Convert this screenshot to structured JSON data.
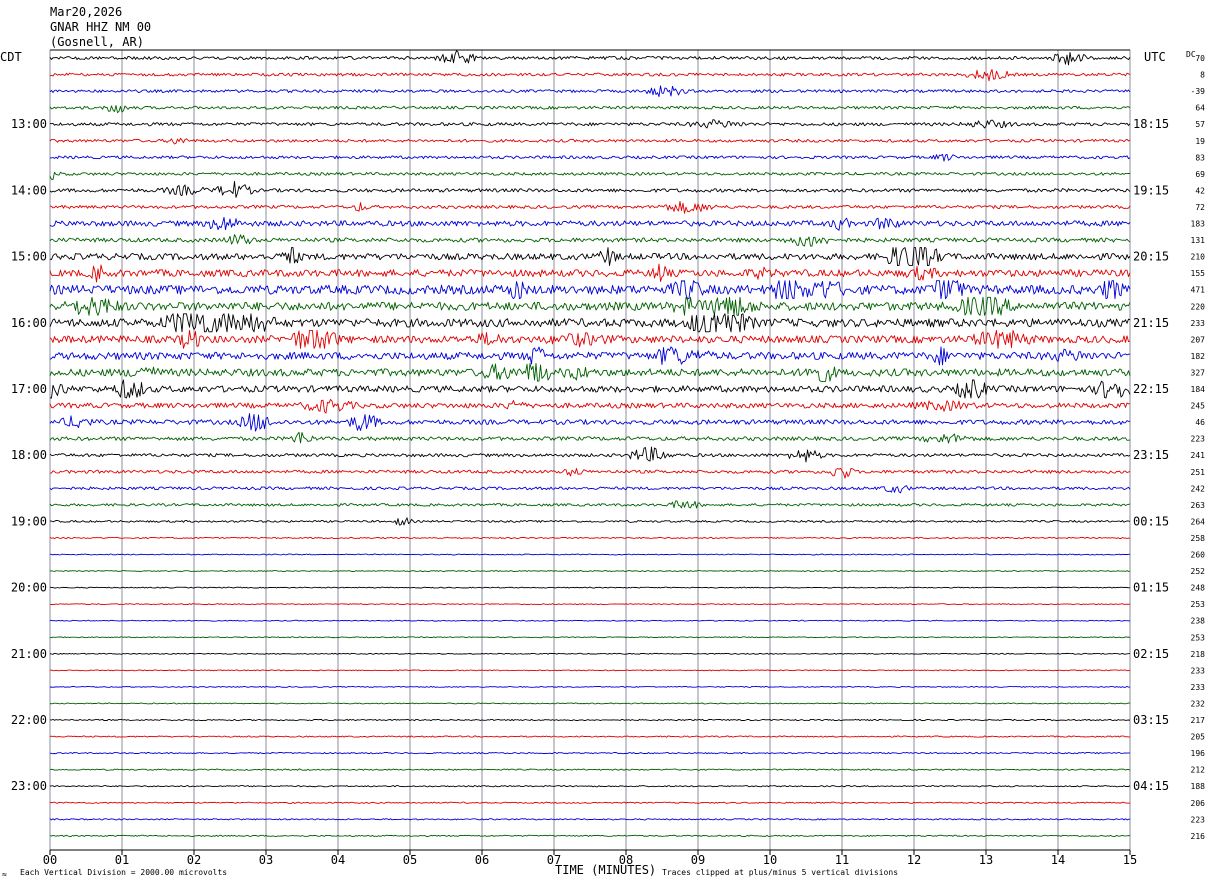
{
  "header": {
    "date": "Mar20,2026",
    "station": "GNAR HHZ NM 00",
    "location": "(Gosnell, AR)"
  },
  "left_tz_label": "CDT",
  "right_tz_label": "UTC",
  "dc_label": "DC",
  "footer": {
    "scale_note": "Each Vertical Division = 2000.00 microvolts",
    "clip_note": "Traces clipped at plus/minus 5 vertical divisions",
    "corner_mark": "≈"
  },
  "colors": {
    "trace_cycle": [
      "#000000",
      "#e00000",
      "#0000d8",
      "#006000"
    ],
    "gridline": "#8c8c9c"
  },
  "chart_data": {
    "type": "helicorder",
    "xlabel": "TIME (MINUTES)",
    "xlim": [
      0,
      15
    ],
    "x_tick_labels": [
      "00",
      "01",
      "02",
      "03",
      "04",
      "05",
      "06",
      "07",
      "08",
      "09",
      "10",
      "11",
      "12",
      "13",
      "14",
      "15"
    ],
    "left_time_labels": [
      "13:00",
      "14:00",
      "15:00",
      "16:00",
      "17:00",
      "18:00",
      "19:00",
      "20:00",
      "21:00",
      "22:00",
      "23:00"
    ],
    "right_time_labels": [
      "18:15",
      "19:15",
      "20:15",
      "21:15",
      "22:15",
      "23:15",
      "00:15",
      "01:15",
      "02:15",
      "03:15",
      "04:15"
    ],
    "rows_per_hour": 4,
    "first_row_offset_minutes": -60,
    "dc_offsets": [
      70,
      8,
      -39,
      64,
      57,
      19,
      83,
      69,
      42,
      72,
      183,
      131,
      210,
      155,
      471,
      220,
      233,
      207,
      182,
      327,
      184,
      245,
      46,
      223,
      241,
      251,
      242,
      263,
      264,
      258,
      260,
      252,
      248,
      253,
      238,
      253,
      218,
      233,
      233,
      232,
      217,
      205,
      196,
      212,
      188,
      206,
      223,
      216
    ],
    "row_activity": [
      1.0,
      0.9,
      0.9,
      0.9,
      1.0,
      0.9,
      0.9,
      0.9,
      1.1,
      1.0,
      1.7,
      1.3,
      2.0,
      2.2,
      2.8,
      2.6,
      2.6,
      2.3,
      2.3,
      2.3,
      2.0,
      1.6,
      1.5,
      1.2,
      1.0,
      1.0,
      0.9,
      0.8,
      0.6,
      0.4,
      0.3,
      0.3,
      0.3,
      0.3,
      0.3,
      0.3,
      0.3,
      0.3,
      0.3,
      0.3,
      0.4,
      0.4,
      0.4,
      0.4,
      0.4,
      0.4,
      0.4,
      0.4
    ]
  }
}
